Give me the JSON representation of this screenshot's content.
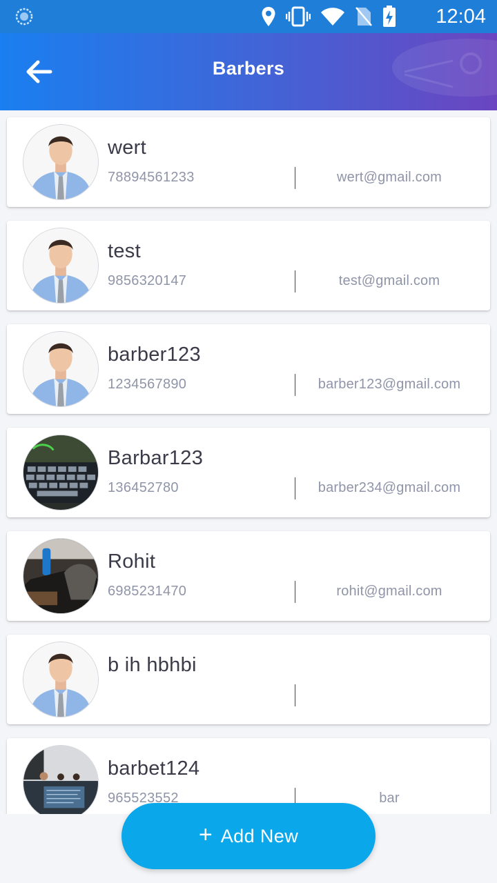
{
  "status_bar": {
    "time": "12:04"
  },
  "header": {
    "title": "Barbers"
  },
  "barbers": [
    {
      "name": "wert",
      "phone": "78894561233",
      "email": "wert@gmail.com",
      "avatar": "default-person"
    },
    {
      "name": "test",
      "phone": "9856320147",
      "email": "test@gmail.com",
      "avatar": "default-person"
    },
    {
      "name": "barber123",
      "phone": "1234567890",
      "email": "barber123@gmail.com",
      "avatar": "default-person"
    },
    {
      "name": "Barbar123",
      "phone": "136452780",
      "email": "barber234@gmail.com",
      "avatar": "keyboard-photo"
    },
    {
      "name": "Rohit",
      "phone": "6985231470",
      "email": "rohit@gmail.com",
      "avatar": "desk-photo"
    },
    {
      "name": "b ih hbhbi",
      "phone": "",
      "email": "",
      "avatar": "default-person"
    },
    {
      "name": "barbet124",
      "phone": "965523552",
      "email": "bar",
      "avatar": "office-photo"
    }
  ],
  "add_button": {
    "icon": "+",
    "label": "Add New"
  },
  "colors": {
    "status_bar": "#1f7fd8",
    "header_start": "#1a7ff0",
    "header_end": "#6b45c0",
    "add_button": "#0aa7ea"
  }
}
